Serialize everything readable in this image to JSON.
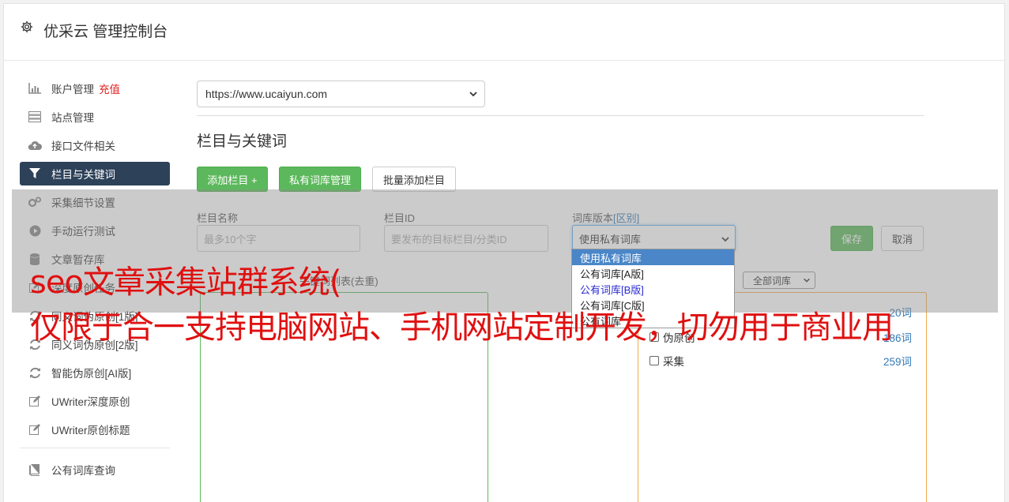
{
  "header": {
    "title": "优采云 管理控制台"
  },
  "sidebar": {
    "items": [
      {
        "label": "账户管理",
        "badge": "充值",
        "icon": "bar-chart-icon"
      },
      {
        "label": "站点管理",
        "icon": "server-icon"
      },
      {
        "label": "接口文件相关",
        "icon": "cloud-upload-icon"
      },
      {
        "label": "栏目与关键词",
        "icon": "filter-icon",
        "active": true
      },
      {
        "label": "采集细节设置",
        "icon": "cogs-icon"
      },
      {
        "label": "手动运行测试",
        "icon": "play-circle-icon"
      },
      {
        "label": "文章暂存库",
        "icon": "database-icon"
      },
      {
        "label": "深度原创任务",
        "icon": "edit-icon"
      },
      {
        "label": "同义词伪原创[1版]",
        "icon": "refresh-icon"
      },
      {
        "label": "同义词伪原创[2版]",
        "icon": "refresh-icon"
      },
      {
        "label": "智能伪原创[AI版]",
        "icon": "refresh-icon"
      },
      {
        "label": "UWriter深度原创",
        "icon": "edit-icon"
      },
      {
        "label": "UWriter原创标题",
        "icon": "edit-icon"
      }
    ],
    "bottom_items": [
      {
        "label": "公有词库查询",
        "icon": "book-icon"
      }
    ]
  },
  "main": {
    "site_select": "https://www.ucaiyun.com",
    "section_title": "栏目与关键词",
    "buttons": {
      "add_column": "添加栏目 +",
      "private_lib": "私有词库管理",
      "batch_add": "批量添加栏目"
    },
    "form": {
      "column_name_label": "栏目名称",
      "column_name_placeholder": "最多10个字",
      "column_id_label": "栏目ID",
      "column_id_placeholder": "要发布的目标栏目/分类ID",
      "lib_version_label": "词库版本",
      "lib_version_diff": "[区别]",
      "lib_version_value": "使用私有词库",
      "save": "保存",
      "cancel": "取消"
    },
    "keywords_label": "关键词列表(去重)",
    "lib_filter": "全部词库",
    "libraries": [
      {
        "name": "伪原创",
        "count": "186词"
      },
      {
        "name": "采集",
        "count": "259词"
      }
    ],
    "partial_count": "20词"
  },
  "dropdown": {
    "options": [
      "使用私有词库",
      "公有词库[A版]",
      "公有词库[B版]",
      "公有词库[C版]",
      "公有词库"
    ]
  },
  "watermark": {
    "line1": "seo文章采集站群系统(",
    "line2": "仅限于合一支持电脑网站、手机网站定制开发，切勿用于商业用"
  },
  "colors": {
    "accent_green": "#5cb85c",
    "active_nav": "#2d4159",
    "watermark_red": "#e01010"
  }
}
